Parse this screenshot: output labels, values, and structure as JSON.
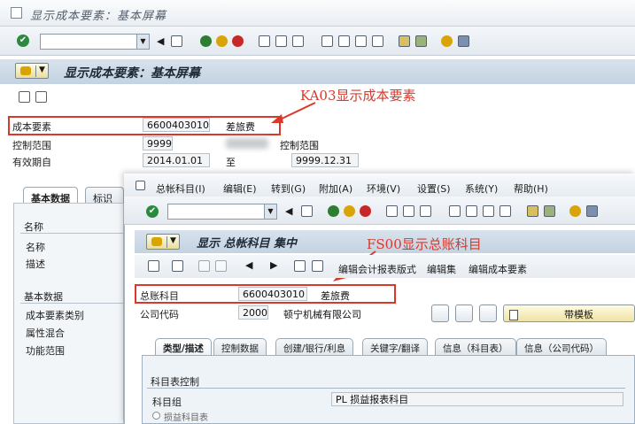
{
  "back_window": {
    "title": "显示成本要素：基本屏幕",
    "screen_title": "显示成本要素：基本屏幕",
    "annotation": "KA03显示成本要素",
    "fields": {
      "cost_element_label": "成本要素",
      "cost_element_value": "6600403010",
      "cost_element_desc": "差旅费",
      "controlling_area_label": "控制范围",
      "controlling_area_value": "9999",
      "controlling_area_label2": "控制范围",
      "valid_from_label": "有效期自",
      "valid_from_value": "2014.01.01",
      "valid_to_label": "至",
      "valid_to_value": "9999.12.31"
    },
    "tabs": [
      "基本数据",
      "标识符"
    ],
    "left_panel": {
      "group1_head": "名称",
      "group1_items": [
        "名称",
        "描述"
      ],
      "group2_head": "基本数据",
      "group2_items": [
        "成本要素类别",
        "属性混合",
        "功能范围"
      ]
    }
  },
  "front_window": {
    "menu": [
      "总帐科目(I)",
      "编辑(E)",
      "转到(G)",
      "附加(A)",
      "环境(V)",
      "设置(S)",
      "系统(Y)",
      "帮助(H)"
    ],
    "screen_title": "显示 总帐科目 集中",
    "annotation": "FS00显示总账科目",
    "app_toolbar": [
      "编辑会计报表版式",
      "编辑集",
      "编辑成本要素"
    ],
    "fields": {
      "gl_account_label": "总账科目",
      "gl_account_value": "6600403010",
      "gl_account_desc": "差旅费",
      "company_code_label": "公司代码",
      "company_code_value": "2000",
      "company_name": "顿宁机械有限公司",
      "template_button": "带模板"
    },
    "tabs": [
      "类型/描述",
      "控制数据",
      "创建/银行/利息",
      "关键字/翻译",
      "信息（科目表）",
      "信息（公司代码）"
    ],
    "panel": {
      "group_head": "科目表控制",
      "account_group_label": "科目组",
      "account_group_value": "PL 损益报表科目",
      "radio_label": "损益科目表"
    }
  },
  "colors": {
    "annotation_red": "#d9382a",
    "title_bar": "#c4d3e1"
  }
}
